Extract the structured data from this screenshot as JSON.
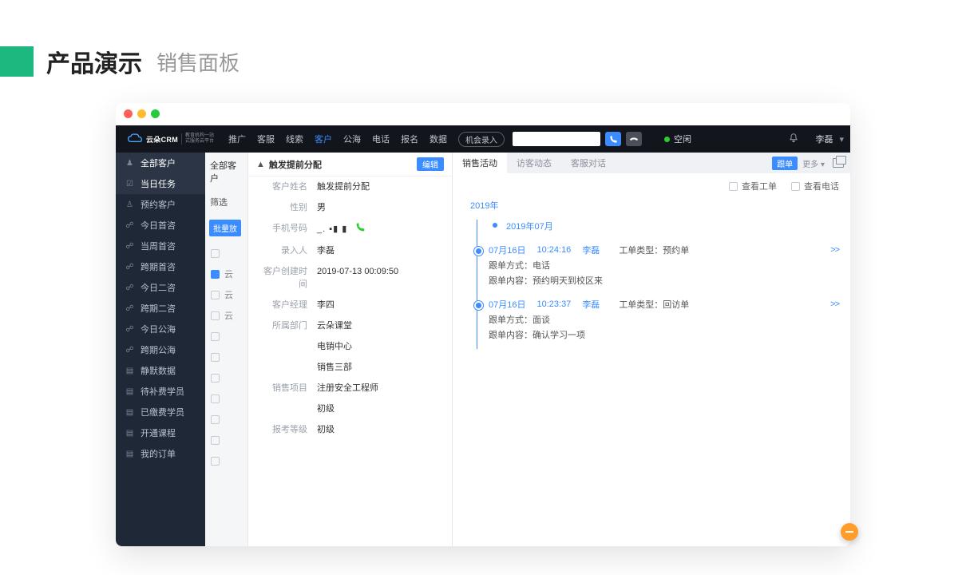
{
  "page_header": {
    "title": "产品演示",
    "subtitle": "销售面板"
  },
  "brand": {
    "name": "云朵CRM",
    "sub1": "教育机构一站",
    "sub2": "式服务云平台"
  },
  "nav": {
    "items": [
      "推广",
      "客服",
      "线索",
      "客户",
      "公海",
      "电话",
      "报名",
      "数据"
    ],
    "active_index": 3,
    "opportunity_btn": "机会录入",
    "status_label": "空闲",
    "user": "李磊"
  },
  "sidebar": {
    "header": "全部客户",
    "items": [
      {
        "label": "当日任务",
        "icon": "☑"
      },
      {
        "label": "预约客户",
        "icon": "♙"
      },
      {
        "label": "今日首咨",
        "icon": "☍"
      },
      {
        "label": "当周首咨",
        "icon": "☍"
      },
      {
        "label": "跨期首咨",
        "icon": "☍"
      },
      {
        "label": "今日二咨",
        "icon": "☍"
      },
      {
        "label": "跨期二咨",
        "icon": "☍"
      },
      {
        "label": "今日公海",
        "icon": "☍"
      },
      {
        "label": "跨期公海",
        "icon": "☍"
      },
      {
        "label": "静默数据",
        "icon": "▤"
      },
      {
        "label": "待补费学员",
        "icon": "▤"
      },
      {
        "label": "已缴费学员",
        "icon": "▤"
      },
      {
        "label": "开通课程",
        "icon": "▤"
      },
      {
        "label": "我的订单",
        "icon": "▤"
      }
    ]
  },
  "mid": {
    "head": "全部客户",
    "filter": "筛选",
    "bulk": "批量放",
    "cells": [
      "云",
      "云",
      "云"
    ]
  },
  "detail": {
    "title": "触发提前分配",
    "edit_btn": "编辑",
    "fields": [
      {
        "label": "客户姓名",
        "value": "触发提前分配"
      },
      {
        "label": "性别",
        "value": "男"
      },
      {
        "label": "手机号码",
        "value": "_. ▪▮ ▮",
        "phone": true
      },
      {
        "label": "录入人",
        "value": "李磊"
      },
      {
        "label": "客户创建时间",
        "value": "2019-07-13 00:09:50"
      },
      {
        "label": "客户经理",
        "value": "李四"
      },
      {
        "label": "所属部门",
        "value": "云朵课堂"
      },
      {
        "label": "",
        "value": "电销中心"
      },
      {
        "label": "",
        "value": "销售三部"
      },
      {
        "label": "销售项目",
        "value": "注册安全工程师"
      },
      {
        "label": "",
        "value": "初级"
      },
      {
        "label": "报考等级",
        "value": "初级"
      }
    ]
  },
  "right": {
    "tabs": [
      "销售活动",
      "访客动态",
      "客服对话"
    ],
    "active_tab": 0,
    "track_btn": "跟单",
    "more_btn": "更多 ▾",
    "filter1": "查看工单",
    "filter2": "查看电话",
    "year": "2019年",
    "month": "2019年07月",
    "items": [
      {
        "date": "07月16日",
        "time": "10:24:16",
        "person": "李磊",
        "type_label": "工单类型：",
        "type_value": "预约单",
        "method_label": "跟单方式：",
        "method_value": "电话",
        "content_label": "跟单内容：",
        "content_value": "预约明天到校区来"
      },
      {
        "date": "07月16日",
        "time": "10:23:37",
        "person": "李磊",
        "type_label": "工单类型：",
        "type_value": "回访单",
        "method_label": "跟单方式：",
        "method_value": "面谈",
        "content_label": "跟单内容：",
        "content_value": "确认学习一项"
      }
    ]
  }
}
